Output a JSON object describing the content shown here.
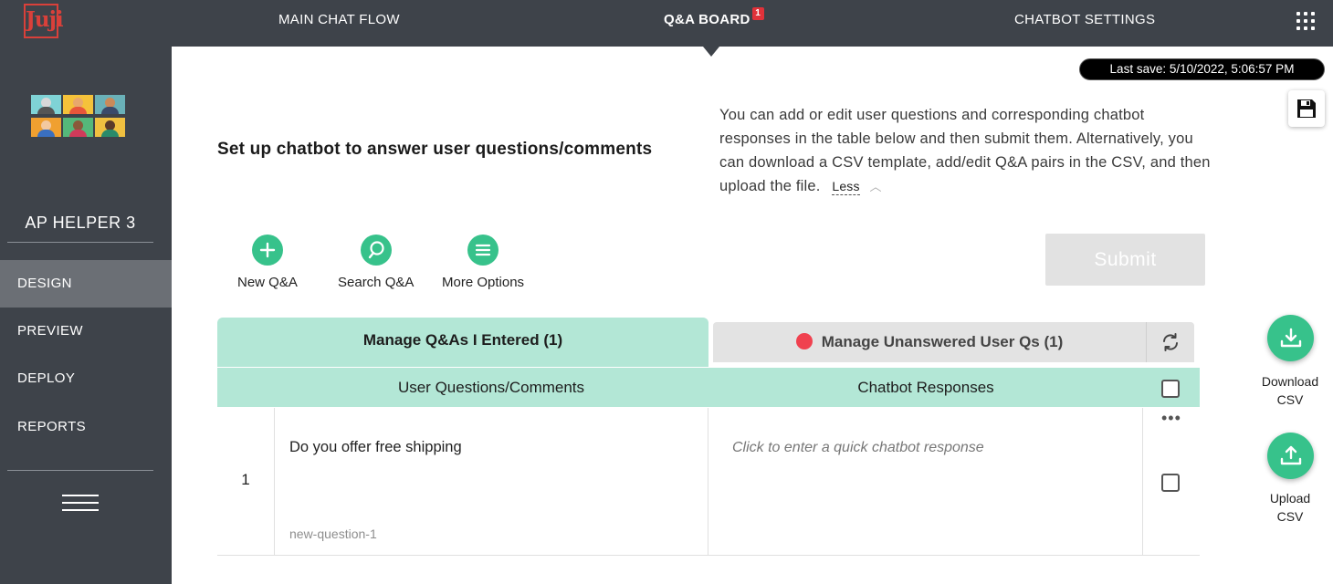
{
  "app": {
    "logo_text": "Juji"
  },
  "topnav": {
    "items": [
      {
        "label": "MAIN CHAT FLOW"
      },
      {
        "label": "Q&A BOARD",
        "badge": "1",
        "active": true
      },
      {
        "label": "CHATBOT SETTINGS"
      }
    ],
    "apps_icon": "grid-icon"
  },
  "sidebar": {
    "project_name": "AP HELPER 3",
    "items": [
      {
        "label": "DESIGN",
        "active": true
      },
      {
        "label": "PREVIEW"
      },
      {
        "label": "DEPLOY"
      },
      {
        "label": "REPORTS"
      }
    ],
    "menu_icon": "hamburger-icon",
    "avatar_colors": [
      "#7fd3d6",
      "#f5c23a",
      "#6ab1b8",
      "#f0a030",
      "#55b87a",
      "#f0c040"
    ]
  },
  "status": {
    "last_save": "Last save: 5/10/2022, 5:06:57 PM",
    "save_icon": "floppy-disk-icon"
  },
  "intro": {
    "heading": "Set up chatbot to answer user questions/comments",
    "description": "You can add or edit user questions and corresponding chatbot responses in the table below and then submit them. Alternatively, you can download a CSV template, add/edit Q&A pairs in the CSV, and then upload the file.",
    "less_label": "Less"
  },
  "actions": {
    "new": "New Q&A",
    "search": "Search Q&A",
    "more": "More Options",
    "submit": "Submit"
  },
  "tabs": {
    "entered": "Manage Q&As I Entered (1)",
    "unanswered": "Manage Unanswered User Qs (1)"
  },
  "table": {
    "columns": [
      "User Questions/Comments",
      "Chatbot Responses"
    ],
    "rows": [
      {
        "num": "1",
        "question": "Do you offer free shipping",
        "question_id": "new-question-1",
        "response_placeholder": "Click to enter a quick chatbot response"
      }
    ]
  },
  "csv": {
    "download_line1": "Download",
    "download_line2": "CSV",
    "upload_line1": "Upload",
    "upload_line2": "CSV"
  },
  "colors": {
    "topbar": "#3e434a",
    "accent_green": "#37c28b",
    "mint": "#b3e7d6",
    "alert_red": "#f0414f"
  }
}
